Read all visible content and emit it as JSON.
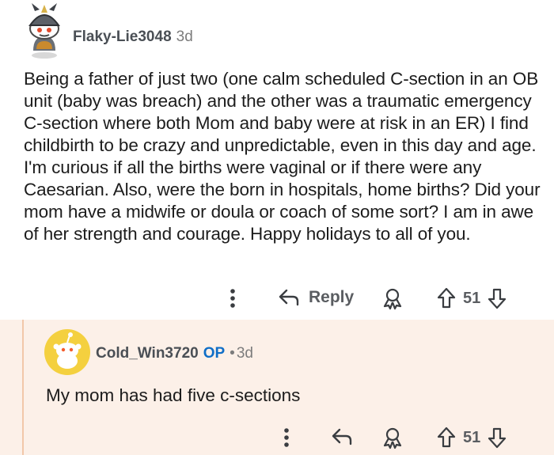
{
  "comment": {
    "author": "Flaky-Lie3048",
    "age": "3d",
    "body": "Being a father of just two (one calm scheduled C-section in an OB unit (baby was breach) and the other was a traumatic emergency C-section where both Mom and baby were at risk in an ER) I find childbirth to be crazy and unpredictable, even in this day and age. I'm curious if all the births were vaginal or if there were any Caesarian. Also, were the born in hospitals, home births? Did your mom have a midwife or doula or coach of some sort? I am in awe of her strength and courage. Happy holidays to all of you.",
    "actions": {
      "reply_label": "Reply",
      "vote_count": "51"
    }
  },
  "reply": {
    "author": "Cold_Win3720",
    "op_badge": "OP",
    "separator": "•",
    "age": "3d",
    "body": "My mom has had five c-sections",
    "actions": {
      "vote_count": "51"
    }
  },
  "icons": {
    "more": "vertical-dots-icon",
    "reply": "reply-arrow-icon",
    "award": "award-icon",
    "upvote": "upvote-arrow-icon",
    "downvote": "downvote-arrow-icon"
  },
  "colors": {
    "reply_background": "#fcf0e8",
    "thread_line": "#f2c7a9",
    "op_badge": "#0f6ec7",
    "reply_avatar": "#f4d03f"
  }
}
